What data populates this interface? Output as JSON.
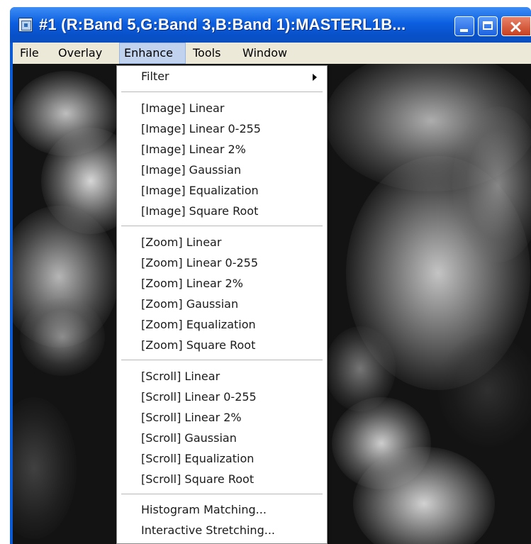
{
  "window": {
    "title": "#1 (R:Band 5,G:Band 3,B:Band 1):MASTERL1B...",
    "icons": [
      "app-icon",
      "minimize-icon",
      "maximize-icon",
      "close-icon"
    ]
  },
  "menubar": {
    "items": [
      {
        "label": "File"
      },
      {
        "label": "Overlay"
      },
      {
        "label": "Enhance",
        "active": true
      },
      {
        "label": "Tools"
      },
      {
        "label": "Window"
      }
    ]
  },
  "enhance_menu": {
    "filter": {
      "label": "Filter",
      "has_submenu": true
    },
    "image": [
      "[Image] Linear",
      "[Image] Linear 0-255",
      "[Image] Linear 2%",
      "[Image] Gaussian",
      "[Image] Equalization",
      "[Image] Square Root"
    ],
    "zoom": [
      "[Zoom] Linear",
      "[Zoom] Linear 0-255",
      "[Zoom] Linear 2%",
      "[Zoom] Gaussian",
      "[Zoom] Equalization",
      "[Zoom] Square Root"
    ],
    "scroll": [
      "[Scroll] Linear",
      "[Scroll] Linear 0-255",
      "[Scroll] Linear 2%",
      "[Scroll] Gaussian",
      "[Scroll] Equalization",
      "[Scroll] Square Root"
    ],
    "other": [
      "Histogram Matching...",
      "Interactive Stretching..."
    ]
  },
  "colors": {
    "titlebar": "#0c5fe0",
    "menubar": "#ece9d8",
    "menu_highlight": "#c1d2ee",
    "canvas": "#131313"
  }
}
